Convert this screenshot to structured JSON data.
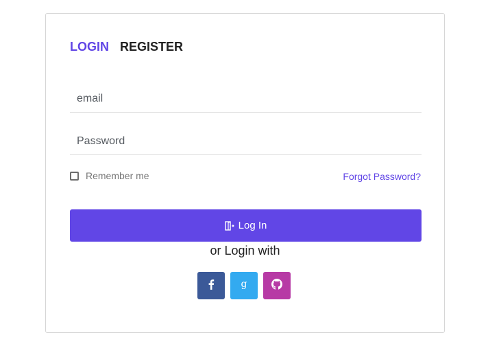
{
  "tabs": {
    "login": "LOGIN",
    "register": "REGISTER"
  },
  "form": {
    "email_placeholder": "email",
    "password_placeholder": "Password",
    "remember_label": "Remember me",
    "forgot_label": "Forgot Password?",
    "login_button": "Log In",
    "or_login_with": "or Login with"
  },
  "social": [
    {
      "icon": "facebook-icon",
      "color": "#3b5998"
    },
    {
      "icon": "google-icon",
      "color": "#33aaf0"
    },
    {
      "icon": "github-icon",
      "color": "#b73aa5"
    }
  ],
  "colors": {
    "accent": "#6146e6"
  }
}
